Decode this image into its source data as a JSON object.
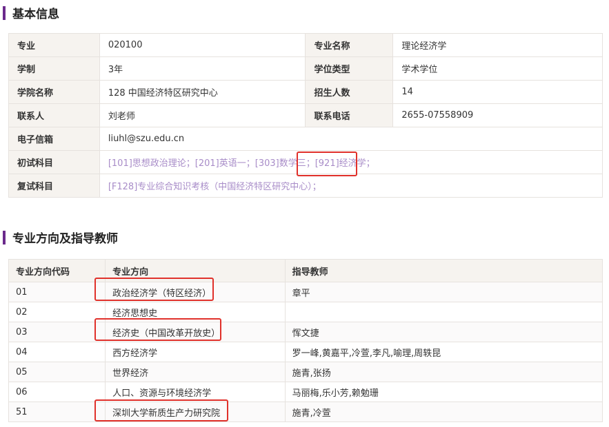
{
  "section1": {
    "title": "基本信息"
  },
  "info": {
    "rows": [
      {
        "l1": "专业",
        "v1": "020100",
        "l2": "专业名称",
        "v2": "理论经济学"
      },
      {
        "l1": "学制",
        "v1": "3年",
        "l2": "学位类型",
        "v2": "学术学位"
      },
      {
        "l1": "学院名称",
        "v1": "128 中国经济特区研究中心",
        "l2": "招生人数",
        "v2": "14"
      },
      {
        "l1": "联系人",
        "v1": "刘老师",
        "l2": "联系电话",
        "v2": "2655-07558909"
      }
    ],
    "email": {
      "label": "电子信箱",
      "value": "liuhl@szu.edu.cn"
    },
    "prelim": {
      "label": "初试科目",
      "value": "[101]思想政治理论；[201]英语一；[303]数学三；[921]经济学；"
    },
    "retest": {
      "label": "复试科目",
      "value": "[F128]专业综合知识考核（中国经济特区研究中心）；"
    }
  },
  "section2": {
    "title": "专业方向及指导教师"
  },
  "directions": {
    "headers": {
      "code": "专业方向代码",
      "name": "专业方向",
      "teacher": "指导教师"
    },
    "rows": [
      {
        "code": "01",
        "name": "政治经济学（特区经济）",
        "teacher": "章平"
      },
      {
        "code": "02",
        "name": "经济思想史",
        "teacher": ""
      },
      {
        "code": "03",
        "name": "经济史（中国改革开放史）",
        "teacher": "恽文捷"
      },
      {
        "code": "04",
        "name": "西方经济学",
        "teacher": "罗一峰,黄嘉平,冷萱,李凡,喻理,周轶昆"
      },
      {
        "code": "05",
        "name": "世界经济",
        "teacher": "施青,张扬"
      },
      {
        "code": "06",
        "name": "人口、资源与环境经济学",
        "teacher": "马丽梅,乐小芳,赖勉珊"
      },
      {
        "code": "51",
        "name": "深圳大学新质生产力研究院",
        "teacher": "施青,冷萱"
      }
    ]
  },
  "colors": {
    "accent": "#6b2a8c",
    "link": "#a88cc8",
    "highlight": "#e0302a",
    "label_bg": "#f6f3ef"
  }
}
